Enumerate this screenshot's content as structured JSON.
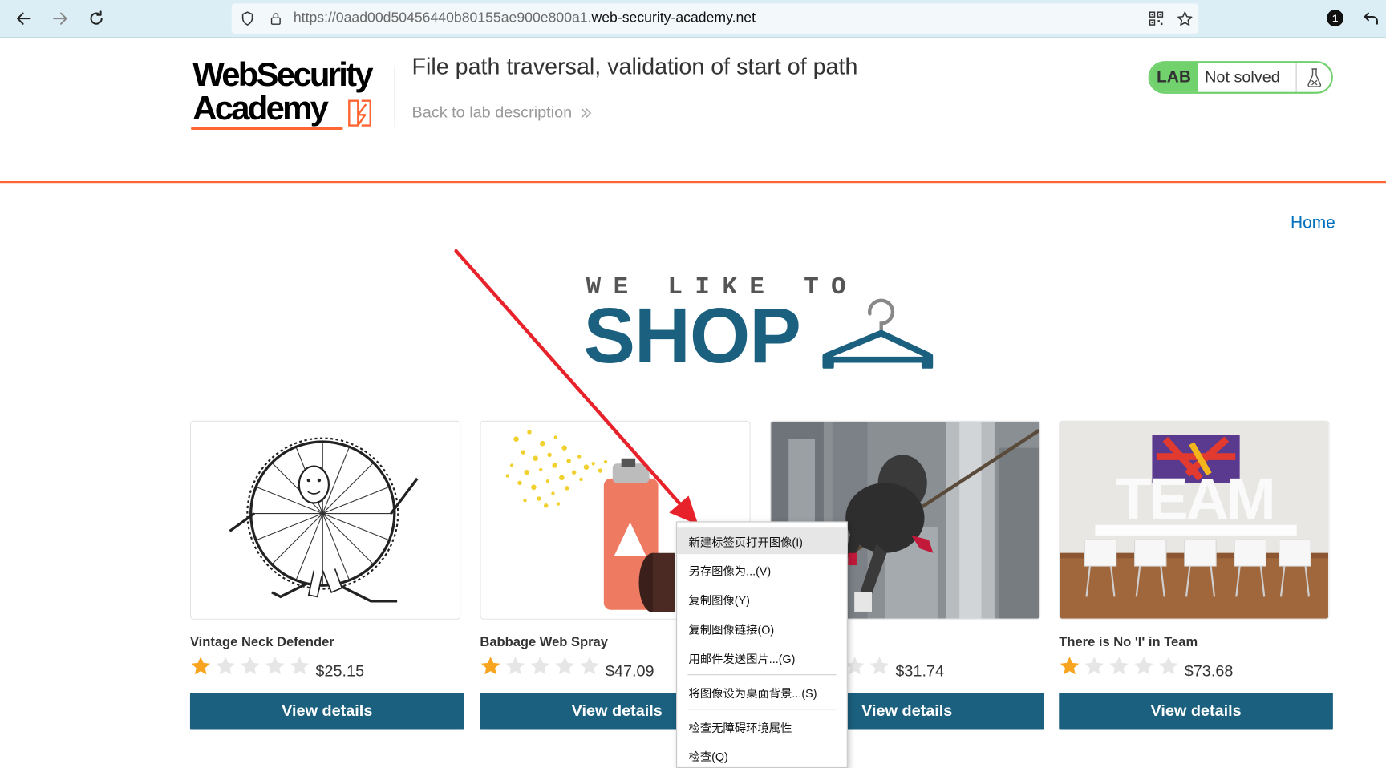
{
  "browser": {
    "url_prefix": "https://0aad00d50456440b80155ae900e800a1.",
    "url_domain": "web-security-academy.net",
    "extension_badge": "1",
    "icons": [
      "back-arrow-icon",
      "forward-arrow-icon",
      "reload-icon",
      "shield-icon",
      "lock-icon",
      "qr-code-icon",
      "bookmark-star-icon",
      "extension-badge-icon",
      "undo-icon"
    ]
  },
  "lab_header": {
    "logo_line1": "WebSecurity",
    "logo_line2": "Academy",
    "title": "File path traversal, validation of start of path",
    "back_link": "Back to lab description",
    "lab_tag": "LAB",
    "status": "Not solved"
  },
  "shop": {
    "home_link": "Home",
    "hero_sub": "WE LIKE TO",
    "hero_main": "SHOP"
  },
  "products": [
    {
      "name": "Vintage Neck Defender",
      "price": "$25.15",
      "rating": 1,
      "button": "View details"
    },
    {
      "name": "Babbage Web Spray",
      "price": "$47.09",
      "rating": 1,
      "button": "View details"
    },
    {
      "name": "",
      "price": "$31.74",
      "rating": 1,
      "button": "View details"
    },
    {
      "name": "There is No 'I' in Team",
      "price": "$73.68",
      "rating": 1,
      "button": "View details"
    }
  ],
  "context_menu": {
    "items": [
      "新建标签页打开图像(I)",
      "另存图像为...(V)",
      "复制图像(Y)",
      "复制图像链接(O)",
      "用邮件发送图片...(G)",
      "将图像设为桌面背景...(S)",
      "检查无障碍环境属性",
      "检查(Q)"
    ]
  },
  "colors": {
    "accent_orange": "#ff6633",
    "shop_blue": "#1b607f",
    "lab_green": "#70d16d",
    "link_blue": "#0071bc",
    "star_gold": "#f7a51f",
    "annotation_red": "#e8222a"
  }
}
